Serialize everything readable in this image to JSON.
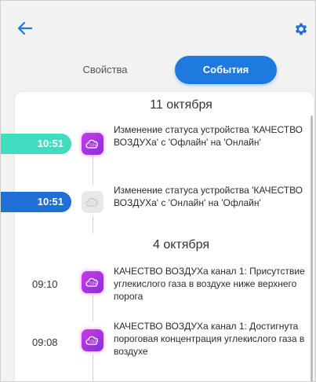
{
  "header": {
    "back_icon": "arrow-left-icon",
    "settings_icon": "gear-icon",
    "accent_color": "#1f7ae0"
  },
  "tabs": [
    {
      "label": "Свойства",
      "active": false
    },
    {
      "label": "События",
      "active": true
    }
  ],
  "groups": [
    {
      "date": "11 октября",
      "events": [
        {
          "time": "10:51",
          "time_style": "teal-pill",
          "icon": "co2-cloud-icon",
          "icon_state": "active",
          "text": "Изменение статуса устройства 'КАЧЕСТВО ВОЗДУХа' с 'Офлайн' на 'Онлайн'"
        },
        {
          "time": "10:51",
          "time_style": "blue-pill",
          "icon": "co2-cloud-icon",
          "icon_state": "inactive",
          "text": "Изменение статуса устройства 'КАЧЕСТВО ВОЗДУХа' с 'Онлайн' на 'Офлайн'"
        }
      ]
    },
    {
      "date": "4 октября",
      "events": [
        {
          "time": "09:10",
          "time_style": "plain",
          "icon": "co2-cloud-icon",
          "icon_state": "active",
          "text": "КАЧЕСТВО ВОЗДУХа канал 1: Присутствие углекислого газа в воздухе ниже верхнего порога"
        },
        {
          "time": "09:08",
          "time_style": "plain",
          "icon": "co2-cloud-icon",
          "icon_state": "active",
          "text": "КАЧЕСТВО ВОЗДУХа канал 1: Достигнута пороговая концентрация углекислого газа в воздухе"
        }
      ]
    }
  ]
}
